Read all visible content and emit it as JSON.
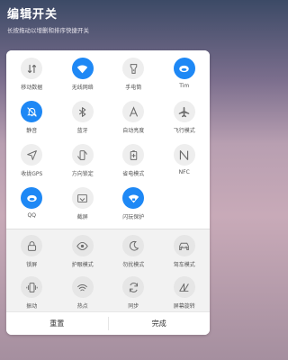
{
  "header": {
    "title": "编辑开关",
    "subtitle": "长按拖动以增删和排序快捷开关"
  },
  "active_tiles": [
    {
      "label": "移动数据",
      "icon": "mobile-data-icon",
      "on": false
    },
    {
      "label": "无线网络",
      "icon": "wifi-icon",
      "on": true
    },
    {
      "label": "手电筒",
      "icon": "flashlight-icon",
      "on": false
    },
    {
      "label": "Tim",
      "icon": "tim-icon",
      "on": true
    },
    {
      "label": "静音",
      "icon": "mute-bell-icon",
      "on": true
    },
    {
      "label": "蓝牙",
      "icon": "bluetooth-icon",
      "on": false
    },
    {
      "label": "自动亮度",
      "icon": "auto-brightness-icon",
      "on": false
    },
    {
      "label": "飞行模式",
      "icon": "airplane-icon",
      "on": false
    },
    {
      "label": "收拢GPS",
      "icon": "gps-icon",
      "on": false
    },
    {
      "label": "方向锁定",
      "icon": "rotation-lock-icon",
      "on": false
    },
    {
      "label": "省电模式",
      "icon": "battery-saver-icon",
      "on": false
    },
    {
      "label": "NFC",
      "icon": "nfc-icon",
      "on": false
    },
    {
      "label": "QQ",
      "icon": "qq-icon",
      "on": true
    },
    {
      "label": "截屏",
      "icon": "screenshot-icon",
      "on": false
    },
    {
      "label": "闪玩保护",
      "icon": "wifi-shield-icon",
      "on": true
    }
  ],
  "inactive_tiles": [
    {
      "label": "锁屏",
      "icon": "lock-icon"
    },
    {
      "label": "护眼模式",
      "icon": "eye-icon"
    },
    {
      "label": "勿扰模式",
      "icon": "moon-icon"
    },
    {
      "label": "驾车模式",
      "icon": "car-icon"
    },
    {
      "label": "振动",
      "icon": "vibrate-icon"
    },
    {
      "label": "热点",
      "icon": "hotspot-icon"
    },
    {
      "label": "同步",
      "icon": "sync-icon"
    },
    {
      "label": "屏幕旋转",
      "icon": "rotate-screen-icon"
    }
  ],
  "footer": {
    "reset_label": "重置",
    "done_label": "完成"
  },
  "colors": {
    "accent": "#1e88f5",
    "tile_off": "#eeeeee"
  }
}
